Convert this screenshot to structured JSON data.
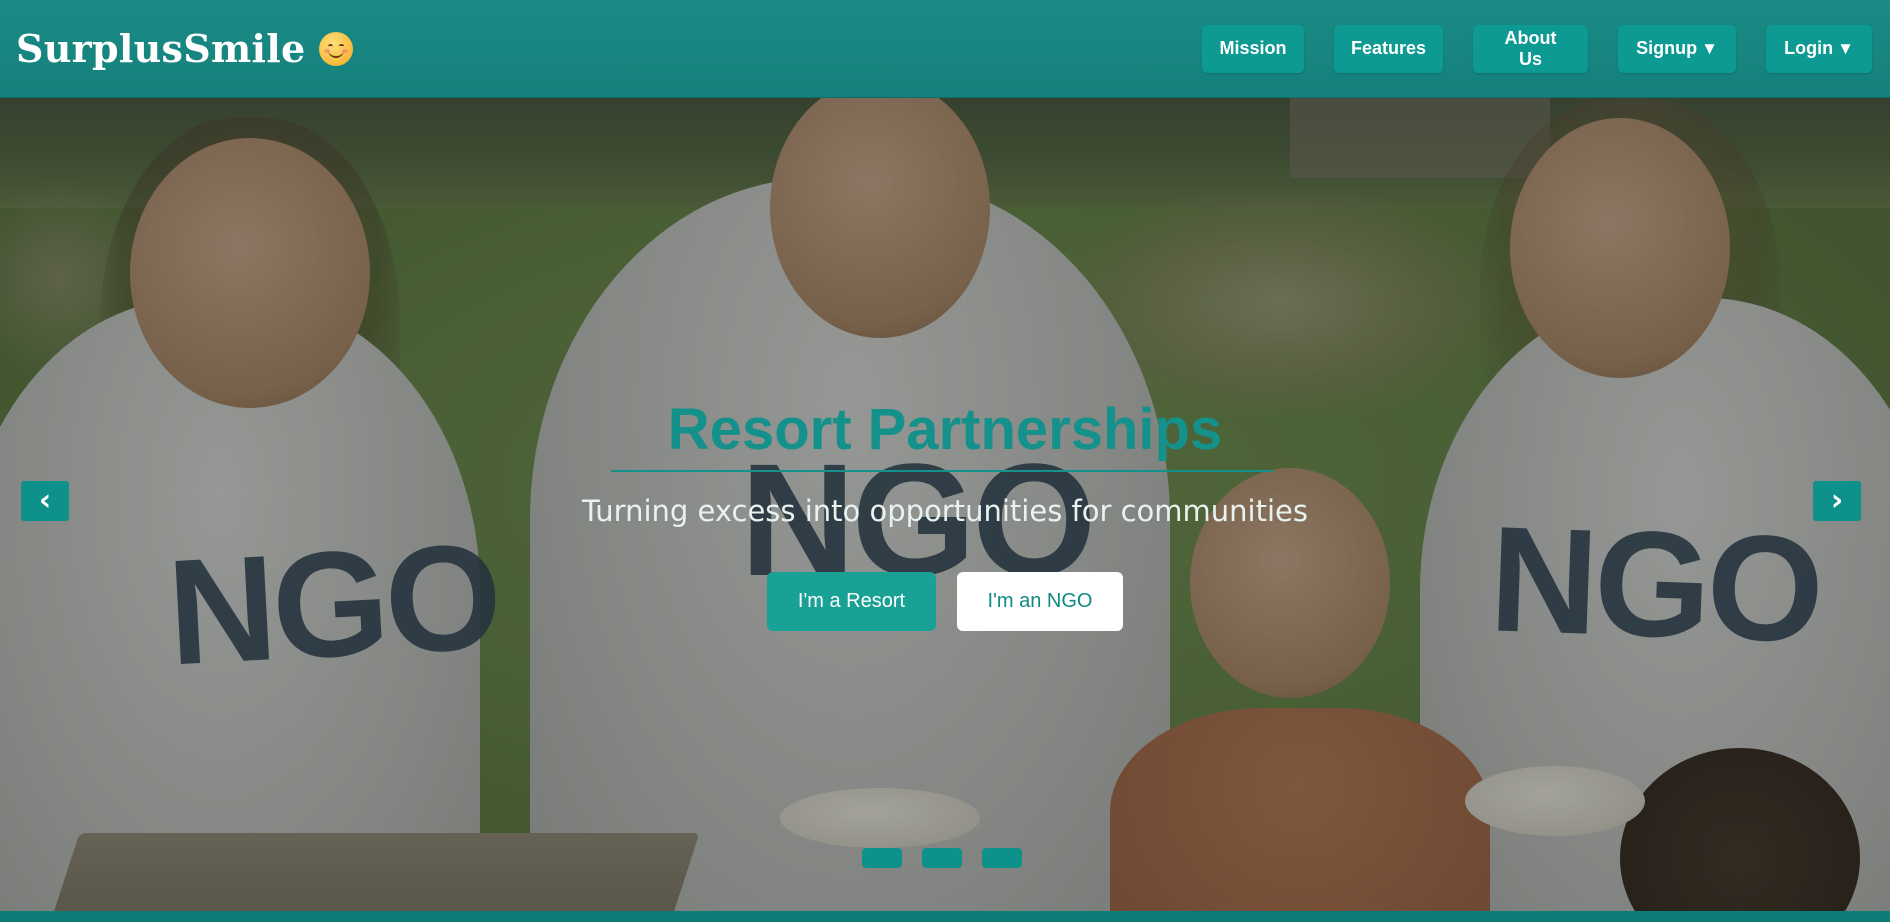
{
  "brand": {
    "name": "SurplusSmile",
    "emoji_icon": "smiling-face-icon"
  },
  "nav": {
    "items": [
      {
        "label": "Mission"
      },
      {
        "label": "Features"
      },
      {
        "label": "About Us"
      },
      {
        "label": "Signup",
        "caret": "▼"
      },
      {
        "label": "Login",
        "caret": "▼"
      }
    ]
  },
  "hero": {
    "title": "Resort Partnerships",
    "subtitle": "Turning excess into opportunities for communities",
    "buttons": {
      "resort": "I'm a Resort",
      "ngo": "I'm an NGO"
    },
    "prev_arrow": "‹",
    "next_arrow": "›",
    "slide_count": 3,
    "image_text": "NGO"
  },
  "colors": {
    "nav_bg": "#168580",
    "accent": "#14918b",
    "button_teal": "#1aa196",
    "white": "#ffffff"
  }
}
